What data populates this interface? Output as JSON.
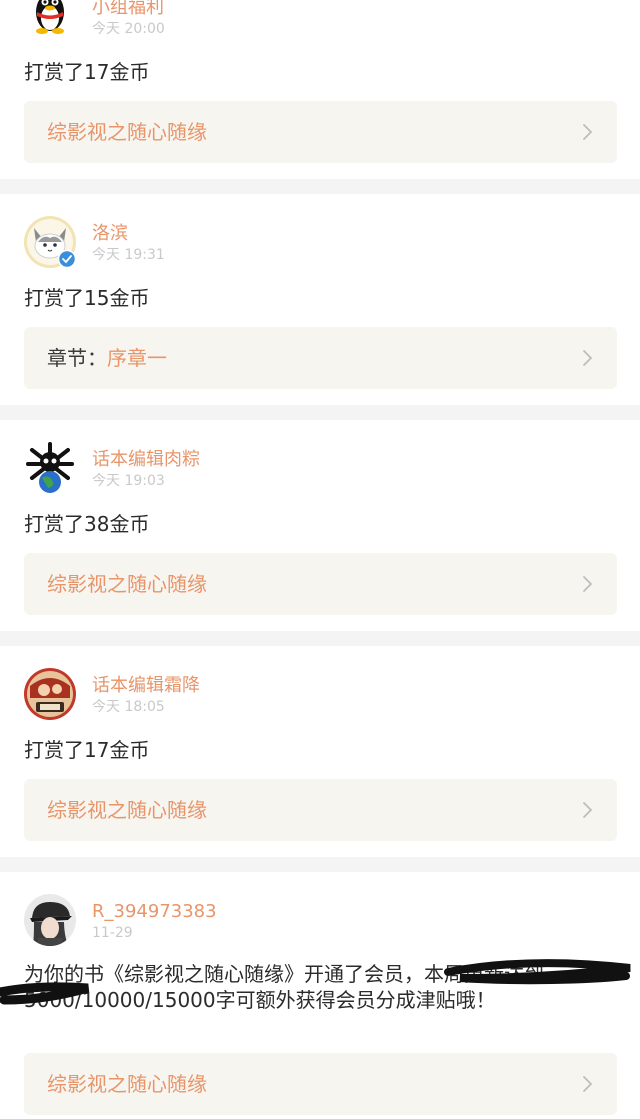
{
  "feed": [
    {
      "avatar_icon": "qq-penguin-avatar-icon",
      "username": "小组福利",
      "time": "今天 20:00",
      "message": "打赏了17金币",
      "link": {
        "prefix": "",
        "title": "综影视之随心随缘"
      }
    },
    {
      "avatar_icon": "cat-avatar-icon",
      "verified": true,
      "username": "洛滨",
      "time": "今天 19:31",
      "message": "打赏了15金币",
      "link": {
        "prefix": "章节：",
        "title": "序章一"
      }
    },
    {
      "avatar_icon": "skull-globe-avatar-icon",
      "username": "话本编辑肉粽",
      "time": "今天 19:03",
      "message": "打赏了38金币",
      "link": {
        "prefix": "",
        "title": "综影视之随心随缘"
      }
    },
    {
      "avatar_icon": "illustrated-avatar-icon",
      "username": "话本编辑霜降",
      "time": "今天 18:05",
      "message": "打赏了17金币",
      "link": {
        "prefix": "",
        "title": "综影视之随心随缘"
      }
    },
    {
      "avatar_icon": "girl-cap-avatar-icon",
      "username": "R_394973383",
      "time": "11-29",
      "message": "为你的书《综影视之随心随缘》开通了会员，本周更新达到5000/10000/15000字可额外获得会员分成津贴哦！",
      "link": {
        "prefix": "",
        "title": "综影视之随心随缘"
      }
    }
  ],
  "colors": {
    "accent": "#e8956a",
    "timestamp": "#c9c9c9",
    "link_bg": "#f7f5ef",
    "page_bg": "#f4f4f4",
    "verified_badge": "#3b8ed8"
  }
}
